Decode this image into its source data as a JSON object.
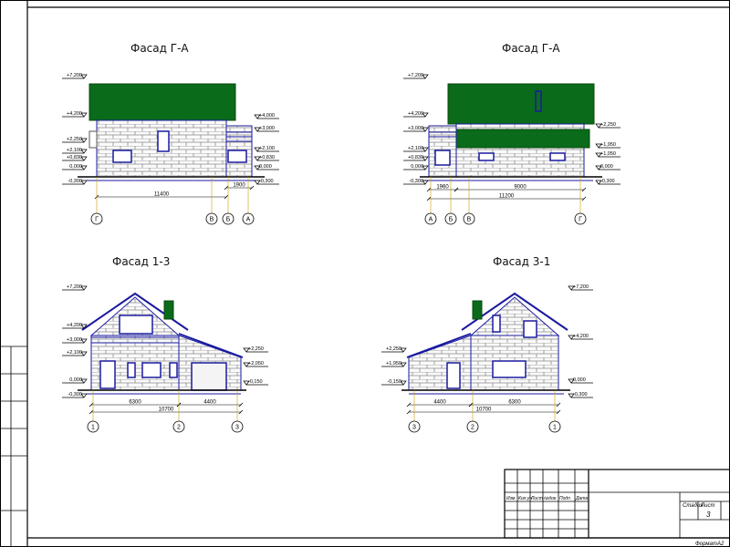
{
  "sheet": {
    "titles": {
      "facade_top_left": "Фасад Г-А",
      "facade_top_right": "Фасад Г-А",
      "facade_bottom_left": "Фасад 1-3",
      "facade_bottom_right": "Фасад 3-1"
    },
    "stamp": {
      "cols": [
        "Изм",
        "Кол.уч",
        "Лист",
        "№док",
        "Подп",
        "Дата"
      ],
      "stage_label": "Стадия",
      "sheet_label": "Лист",
      "sheet_number": "3",
      "format_label": "Формат",
      "format_value": "А2"
    },
    "colors": {
      "roof": "#0a6b1a",
      "lines": "#1a1aa0",
      "brick": "#8c8c8c",
      "frame": "#000000"
    },
    "elev_top_left": {
      "levels_left": [
        "+7,200",
        "+4,200",
        "+2,250",
        "+2,100",
        "+0,830",
        "0,000",
        "-0,300"
      ],
      "levels_right": [
        "+4,000",
        "+3,000",
        "+2,100",
        "+0,830",
        "0,000",
        "-0,300"
      ],
      "dims": [
        "11400",
        "1900"
      ],
      "axes": [
        "Г",
        "В",
        "Б",
        "А"
      ]
    },
    "elev_top_right": {
      "levels_left": [
        "+7,200",
        "+4,200",
        "+3,000",
        "+2,100",
        "+0,830",
        "0,000",
        "-0,300"
      ],
      "levels_right": [
        "+2,250",
        "+1,950",
        "+1,050",
        "0,000",
        "-0,300"
      ],
      "dims": [
        "1960",
        "9000",
        "11200"
      ],
      "axes": [
        "А",
        "Б",
        "В",
        "Г"
      ]
    },
    "elev_bottom_left": {
      "levels_left": [
        "+7,200",
        "+4,200",
        "+3,000",
        "+2,100",
        "0,000",
        "-0,300"
      ],
      "levels_right": [
        "+2,250",
        "+2,050",
        "-0,150"
      ],
      "dims": [
        "6300",
        "4400",
        "10700"
      ],
      "axes": [
        "1",
        "2",
        "3"
      ]
    },
    "elev_bottom_right": {
      "levels_left": [
        "+2,250",
        "+1,950",
        "-0,150"
      ],
      "levels_right": [
        "+7,200",
        "+4,200",
        "0,000",
        "-0,300"
      ],
      "dims": [
        "4400",
        "6300",
        "10700"
      ],
      "axes": [
        "3",
        "2",
        "1"
      ]
    }
  }
}
